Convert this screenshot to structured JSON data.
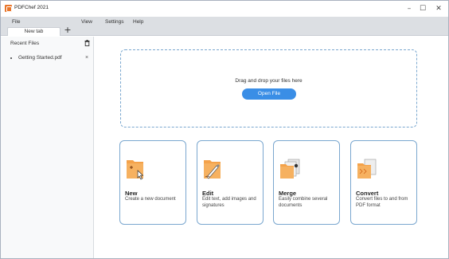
{
  "app": {
    "title": "PDFChef 2021"
  },
  "window_controls": {
    "minimize": "–",
    "maximize": "☐",
    "close": "✕"
  },
  "menu": {
    "file": "File",
    "view": "View",
    "settings": "Settings",
    "help": "Help"
  },
  "tabs": [
    {
      "label": "New tab"
    }
  ],
  "tab_add": "+",
  "sidebar": {
    "title": "Recent Files",
    "items": [
      {
        "label": "Getting Started.pdf",
        "close": "×"
      }
    ]
  },
  "dropzone": {
    "text": "Drag and drop your files here",
    "button": "Open File"
  },
  "cards": [
    {
      "title": "New",
      "desc": "Create a new document",
      "icon": "new-document-icon"
    },
    {
      "title": "Edit",
      "desc": "Edit text, add images and signatures",
      "icon": "edit-document-icon"
    },
    {
      "title": "Merge",
      "desc": "Easily combine several documents",
      "icon": "merge-documents-icon"
    },
    {
      "title": "Convert",
      "desc": "Convert files to and from PDF format",
      "icon": "convert-document-icon"
    }
  ],
  "colors": {
    "accent": "#3a8ee6",
    "orange": "#e9762b",
    "card_border": "#7aa7cf"
  }
}
